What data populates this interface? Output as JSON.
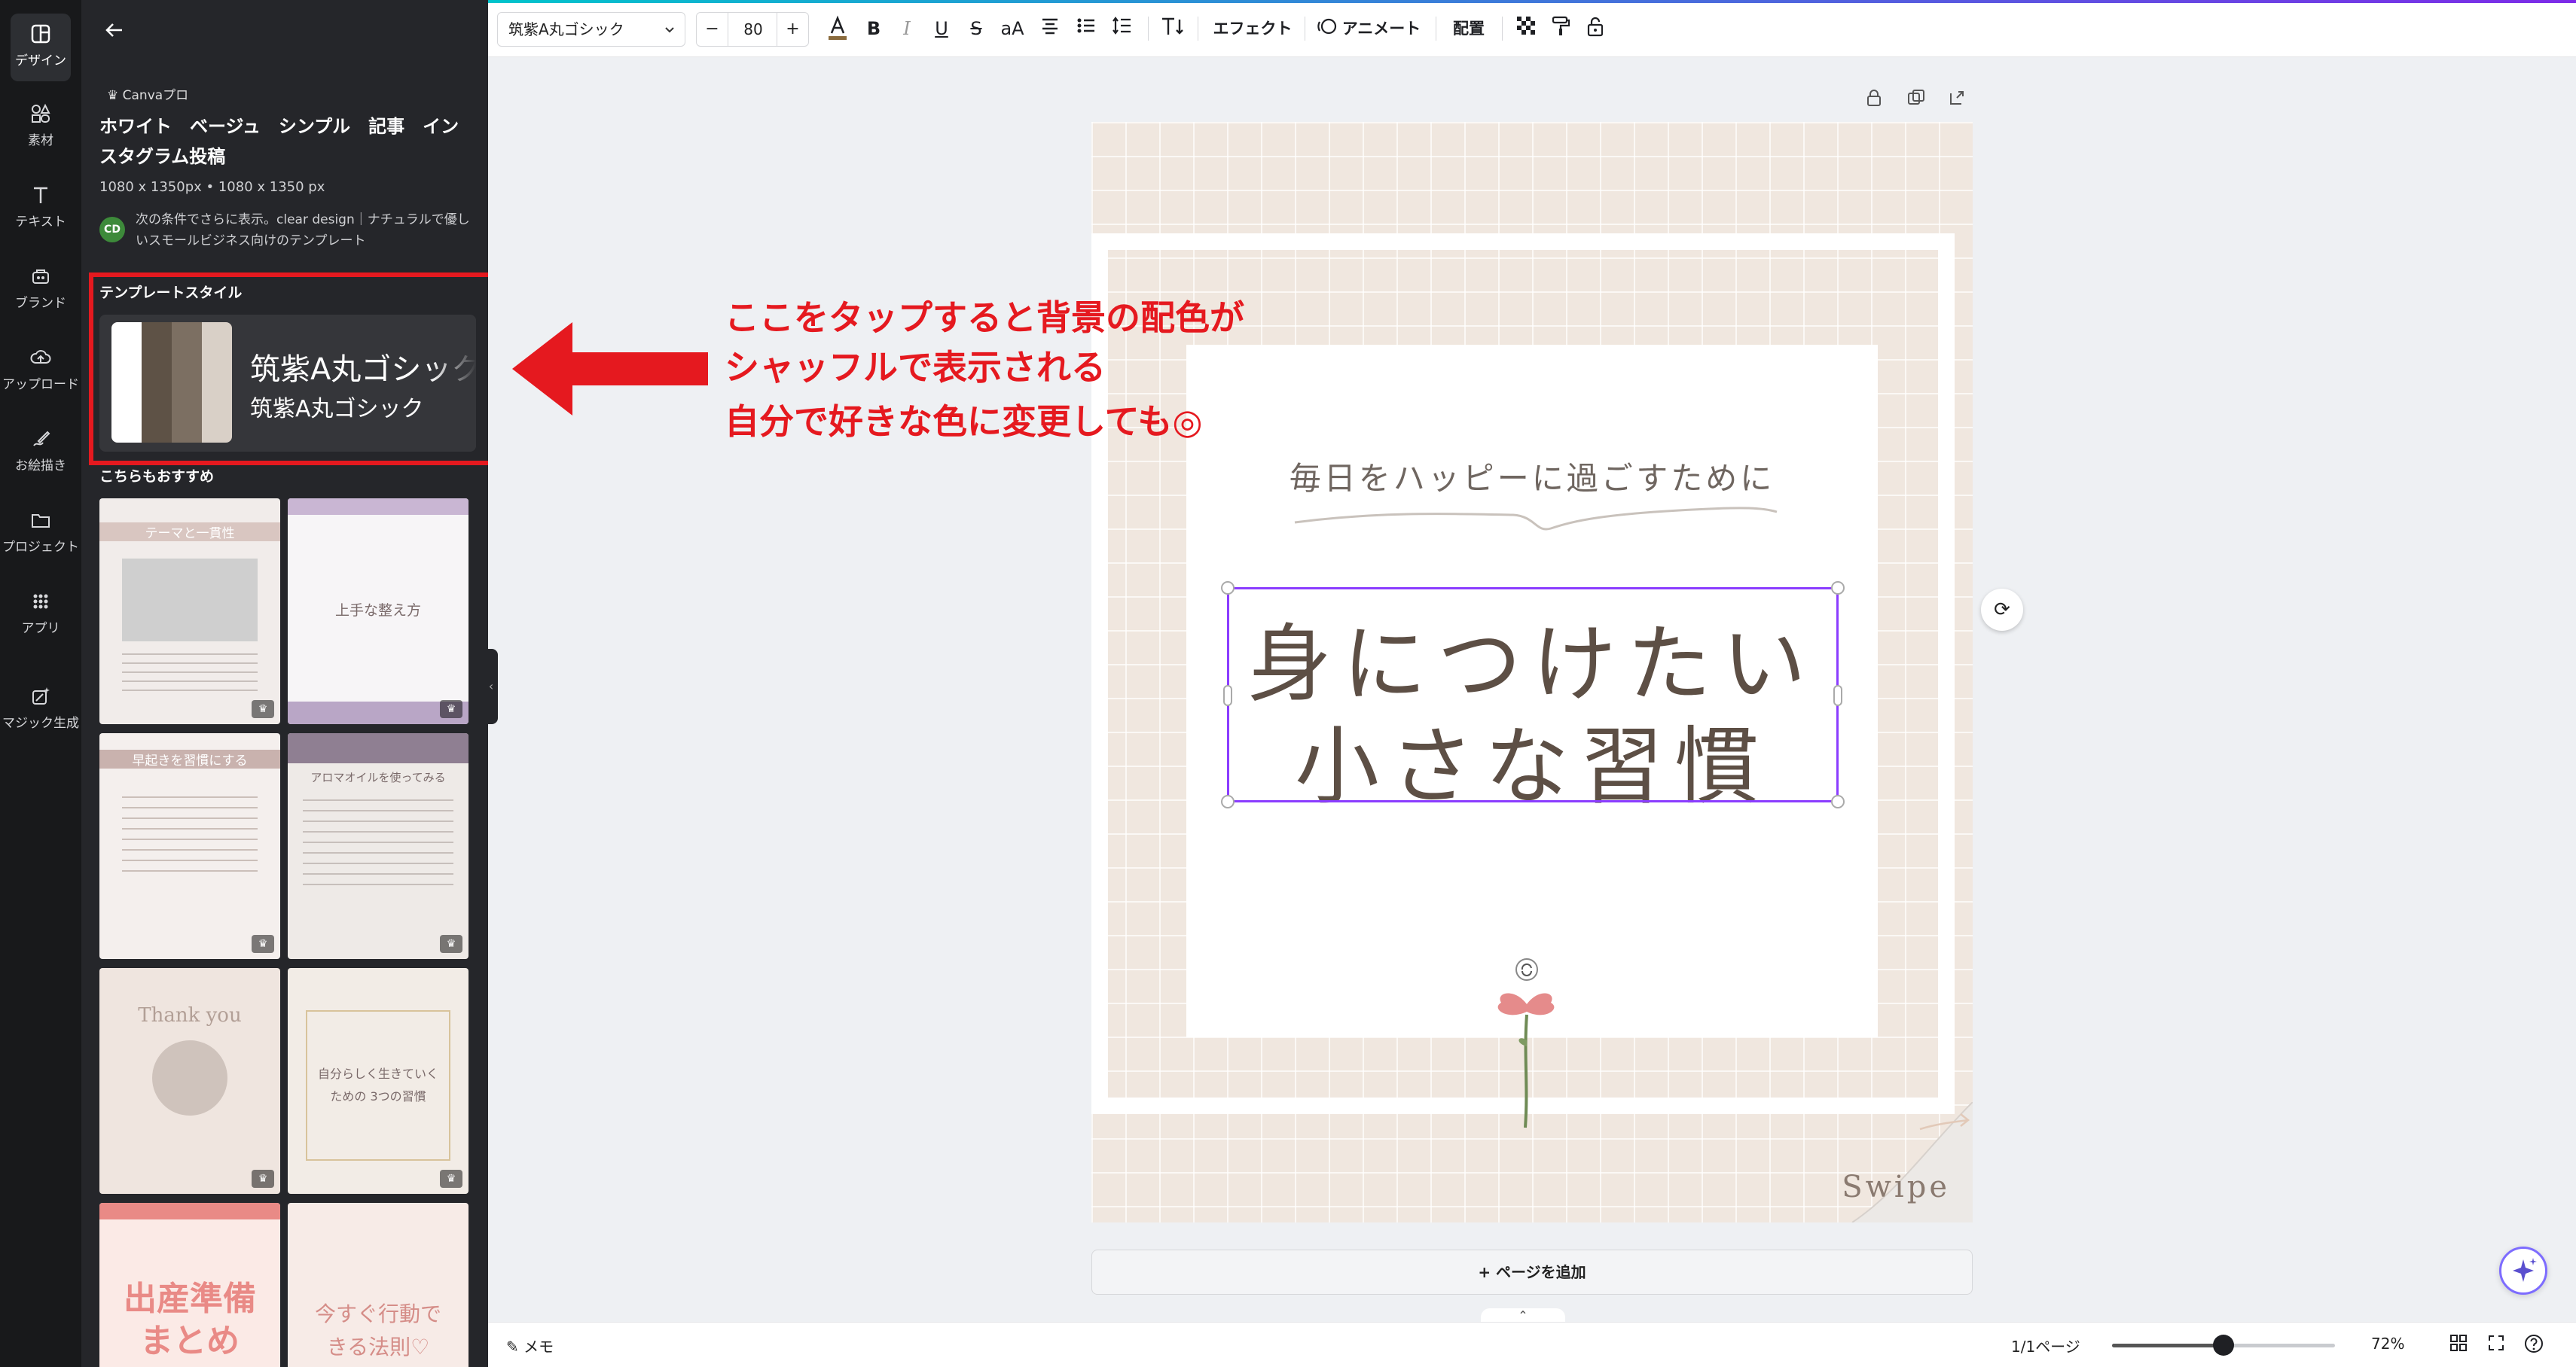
{
  "rail": {
    "items": [
      {
        "label": "デザイン",
        "icon": "design-icon"
      },
      {
        "label": "素材",
        "icon": "elements-icon"
      },
      {
        "label": "テキスト",
        "icon": "text-icon"
      },
      {
        "label": "ブランド",
        "icon": "brand-icon"
      },
      {
        "label": "アップロード",
        "icon": "upload-icon"
      },
      {
        "label": "お絵描き",
        "icon": "draw-icon"
      },
      {
        "label": "プロジェクト",
        "icon": "folder-icon"
      },
      {
        "label": "アプリ",
        "icon": "apps-icon"
      },
      {
        "label": "マジック生成",
        "icon": "magic-icon"
      }
    ]
  },
  "panel": {
    "pro_badge": "♛ Canvaプロ",
    "template_title": "ホワイト　ベージュ　シンプル　記事　インスタグラム投稿",
    "template_size": "1080 x 1350px • 1080 x 1350 px",
    "author_initials": "CD",
    "author_desc": "次の条件でさらに表示。clear design｜ナチュラルで優しいスモールビジネス向けのテンプレート",
    "style_section": "テンプレートスタイル",
    "style_font_1": "筑紫A丸ゴシック",
    "style_font_2": "筑紫A丸ゴシック",
    "style_colors": [
      "#ffffff",
      "#5e5246",
      "#7c6f62",
      "#d9d0c7"
    ],
    "recommend_section": "こちらもおすすめ",
    "thumbs": [
      {
        "text": "テーマと一貫性"
      },
      {
        "text": "上手な整え方"
      },
      {
        "text": "早起きを習慣にする"
      },
      {
        "text": "アロマオイルを使ってみる"
      },
      {
        "text": "Thank you"
      },
      {
        "text": "自分らしく生きていくための 3つの習慣"
      },
      {
        "text": "出産準備 まとめ"
      },
      {
        "text": "今すぐ行動できる法則♡"
      }
    ]
  },
  "toolbar": {
    "font_name": "筑紫A丸ゴシック",
    "font_size": "80",
    "minus": "−",
    "plus": "+",
    "effects": "エフェクト",
    "animate": "アニメート",
    "position": "配置"
  },
  "canvas": {
    "subtitle": "毎日をハッピーに過ごすために",
    "title_line1": "身につけたい",
    "title_line2": "小さな習慣",
    "swipe": "Swipe",
    "add_page": "+ ページを追加"
  },
  "annotation": {
    "line1": "ここをタップすると背景の配色が",
    "line2": "シャッフルで表示される",
    "line3": "自分で好きな色に変更しても◎",
    "color": "#e5191f"
  },
  "bottombar": {
    "memo": "メモ",
    "pages": "1/1ページ",
    "zoom": "72%",
    "zoom_level": 0.5
  }
}
